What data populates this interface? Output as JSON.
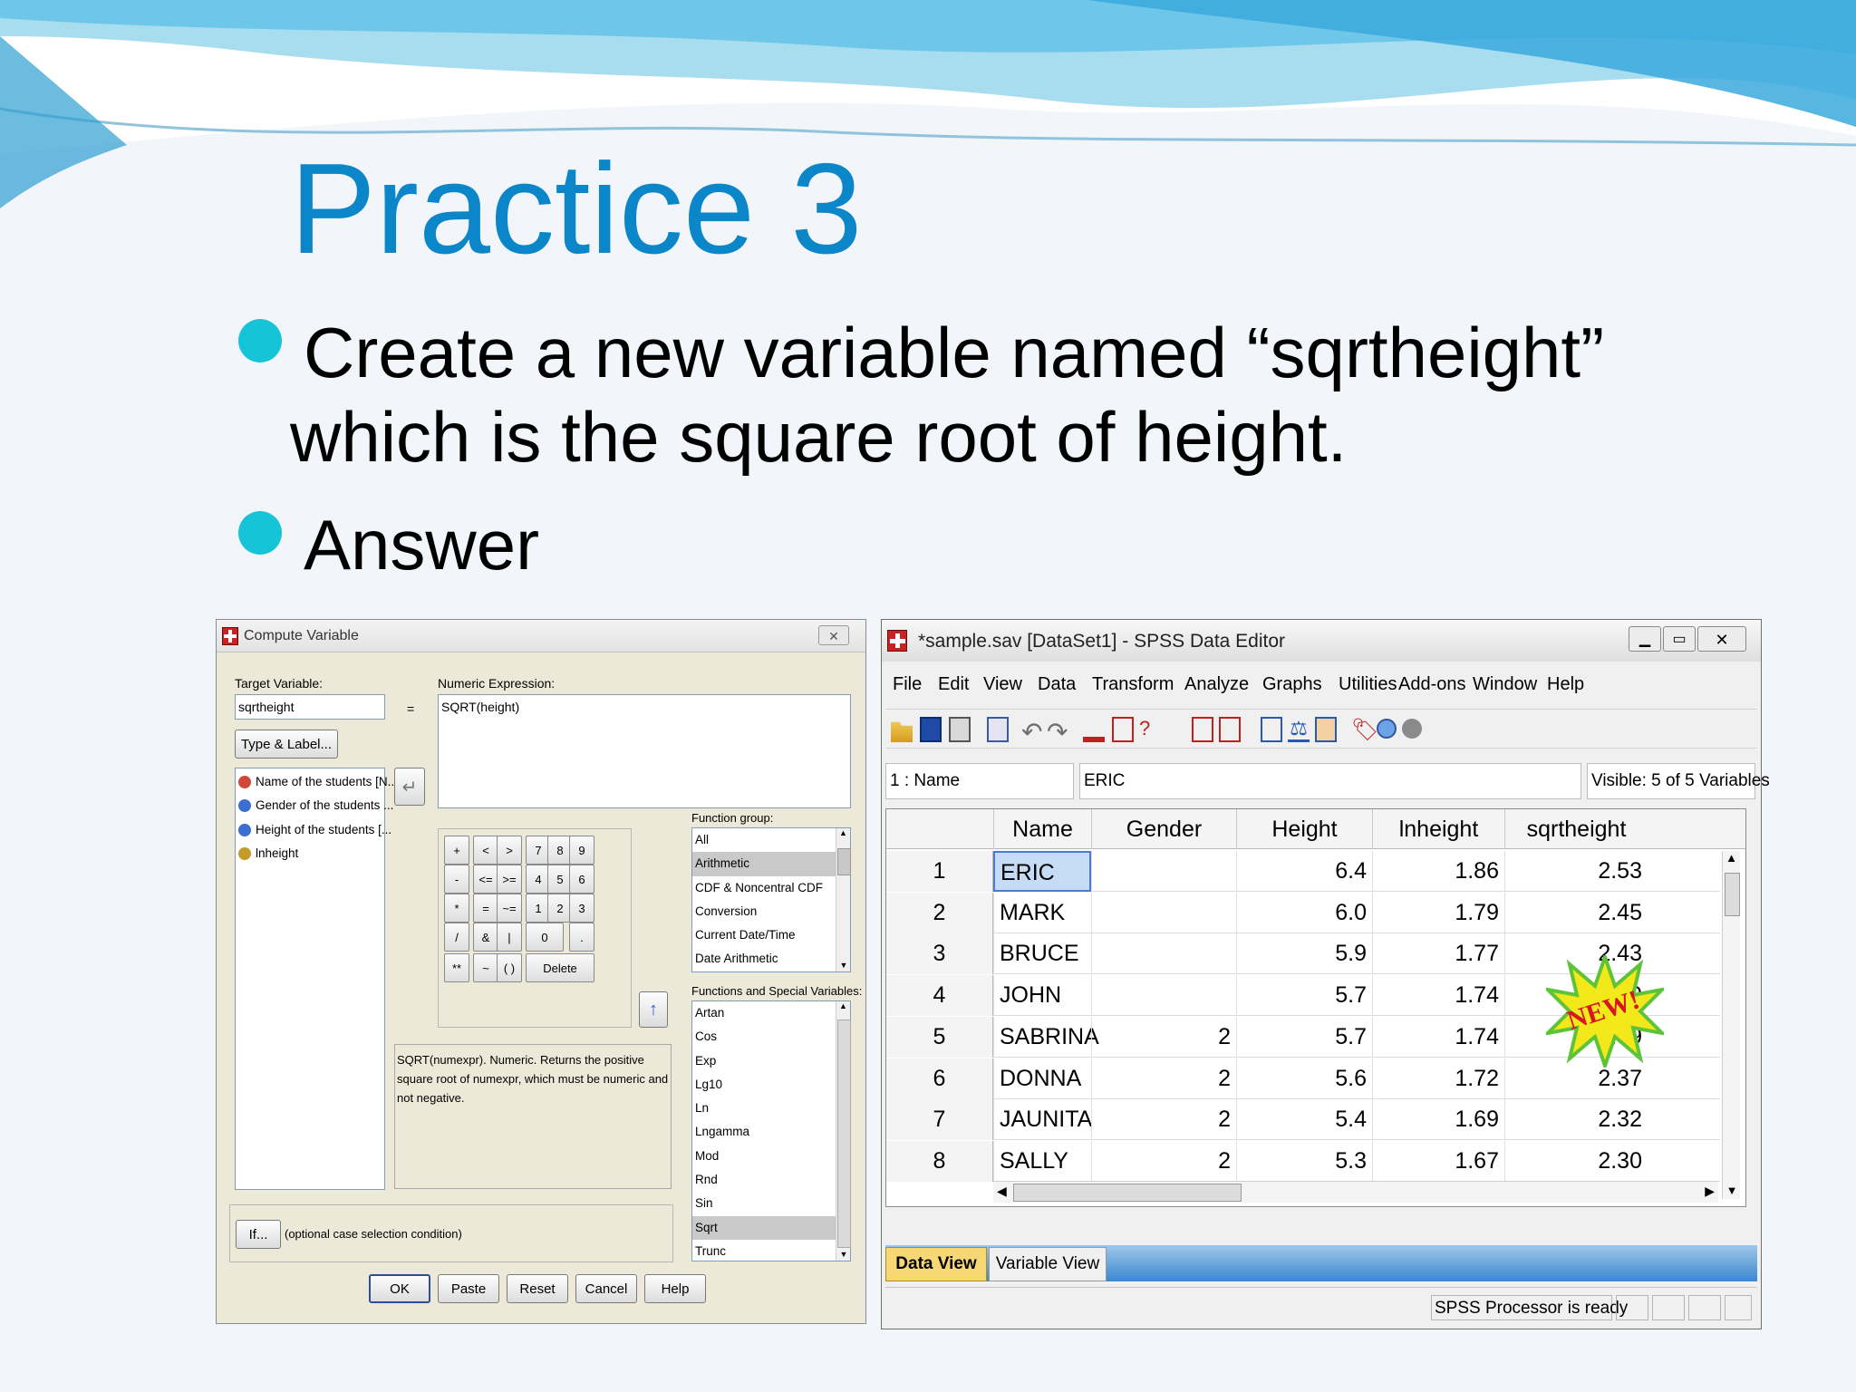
{
  "slide": {
    "title": "Practice 3",
    "bullets": [
      "Create a new variable named “sqrtheight”",
      "which is the square root of height.",
      "Answer"
    ]
  },
  "compute": {
    "title": "Compute Variable",
    "target_label": "Target Variable:",
    "target_value": "sqrtheight",
    "equals": "=",
    "type_label_btn": "Type & Label...",
    "numeric_expr_label": "Numeric Expression:",
    "numeric_expr_value": "SQRT(height)",
    "variables": [
      {
        "label": "Name of the students [N...",
        "icon": "string-var-icon"
      },
      {
        "label": "Gender of the students ...",
        "icon": "nominal-var-icon"
      },
      {
        "label": "Height of the students [...",
        "icon": "nominal-var-icon"
      },
      {
        "label": "lnheight",
        "icon": "scale-var-icon"
      }
    ],
    "calc_rows": [
      [
        "+",
        "<",
        ">",
        "7",
        "8",
        "9"
      ],
      [
        "-",
        "<=",
        ">=",
        "4",
        "5",
        "6"
      ],
      [
        "*",
        "=",
        "~=",
        "1",
        "2",
        "3"
      ],
      [
        "/",
        "&",
        "|",
        "0",
        "."
      ],
      [
        "**",
        "~",
        "( )",
        "Delete"
      ]
    ],
    "function_group_label": "Function group:",
    "function_groups": [
      "All",
      "Arithmetic",
      "CDF & Noncentral CDF",
      "Conversion",
      "Current Date/Time",
      "Date Arithmetic"
    ],
    "functions_label": "Functions and Special Variables:",
    "functions": [
      "Artan",
      "Cos",
      "Exp",
      "Lg10",
      "Ln",
      "Lngamma",
      "Mod",
      "Rnd",
      "Sin",
      "Sqrt",
      "Trunc"
    ],
    "description": "SQRT(numexpr). Numeric. Returns the positive square root of numexpr, which must be numeric and not negative.",
    "if_btn": "If...",
    "if_text": "(optional case selection condition)",
    "buttons": [
      "OK",
      "Paste",
      "Reset",
      "Cancel",
      "Help"
    ]
  },
  "editor": {
    "title": "*sample.sav [DataSet1] - SPSS Data Editor",
    "menu": [
      "File",
      "Edit",
      "View",
      "Data",
      "Transform",
      "Analyze",
      "Graphs",
      "Utilities",
      "Add-ons",
      "Window",
      "Help"
    ],
    "cell_ref": "1 : Name",
    "cell_value": "ERIC",
    "visible": "Visible: 5 of 5 Variables",
    "columns": [
      "Name",
      "Gender",
      "Height",
      "lnheight",
      "sqrtheight"
    ],
    "rows": [
      {
        "n": "1",
        "name": "ERIC",
        "gender": "",
        "height": "6.4",
        "ln": "1.86",
        "sqrt": "2.53"
      },
      {
        "n": "2",
        "name": "MARK",
        "gender": "",
        "height": "6.0",
        "ln": "1.79",
        "sqrt": "2.45"
      },
      {
        "n": "3",
        "name": "BRUCE",
        "gender": "",
        "height": "5.9",
        "ln": "1.77",
        "sqrt": "2.43"
      },
      {
        "n": "4",
        "name": "JOHN",
        "gender": "",
        "height": "5.7",
        "ln": "1.74",
        "sqrt": "2.39"
      },
      {
        "n": "5",
        "name": "SABRINA",
        "gender": "2",
        "height": "5.7",
        "ln": "1.74",
        "sqrt": "2.39"
      },
      {
        "n": "6",
        "name": "DONNA",
        "gender": "2",
        "height": "5.6",
        "ln": "1.72",
        "sqrt": "2.37"
      },
      {
        "n": "7",
        "name": "JAUNITA",
        "gender": "2",
        "height": "5.4",
        "ln": "1.69",
        "sqrt": "2.32"
      },
      {
        "n": "8",
        "name": "SALLY",
        "gender": "2",
        "height": "5.3",
        "ln": "1.67",
        "sqrt": "2.30"
      }
    ],
    "tabs": [
      "Data View",
      "Variable View"
    ],
    "status": "SPSS  Processor is ready",
    "badge": "NEW!"
  },
  "colors": {
    "title": "#0b86c8",
    "bullet": "#16c4d8",
    "selection": "#c6dbf5",
    "badge_star": "#f3e81a"
  }
}
